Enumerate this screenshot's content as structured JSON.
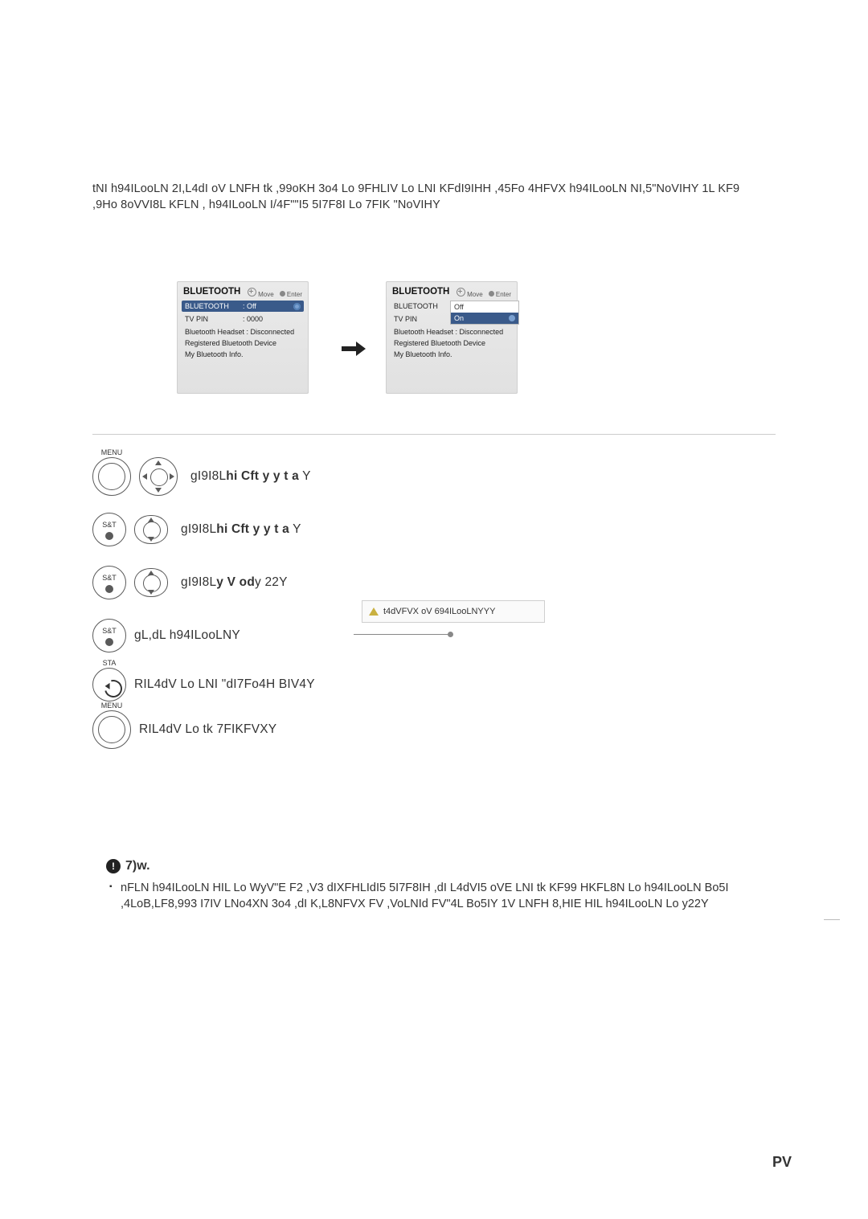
{
  "intro": {
    "line1": "tNI h94ILooLN 2I,L4dI oV LNFH tk ,99oKH 3o4 Lo 9FHLIV Lo LNI KFdI9IHH ,45Fo 4HFVX h94ILooLN NI,5\"NoVIHY 1L KF9",
    "line2": ",9Ho 8oVVI8L KFLN , h94ILooLN I/4F\"\"I5 5I7F8I Lo 7FIK \"NoVIHY"
  },
  "screenshot": {
    "title": "BLUETOOTH",
    "hint_move": "Move",
    "hint_enter": "Enter",
    "rows": {
      "bluetooth_label": "BLUETOOTH",
      "bluetooth_value": ": Off",
      "tvpin_label": "TV PIN",
      "tvpin_value": ": 0000",
      "headset": "Bluetooth Headset : Disconnected",
      "registered": "Registered Bluetooth Device",
      "myinfo": "My Bluetooth Info."
    },
    "dropdown": {
      "off": "Off",
      "on": "On"
    }
  },
  "steps": {
    "s1": {
      "btn": "MENU",
      "text_a": "gI9I8L",
      "text_b": "hi Cft y y t a",
      "text_c": " Y"
    },
    "s2": {
      "btn": "S&T",
      "text_a": "gI9I8L",
      "text_b": "hi Cft y y t a",
      "text_c": " Y"
    },
    "s3": {
      "btn": "S&T",
      "text_a": "gI9I8L",
      "text_b": "y V od",
      "text_c": "y 22Y"
    },
    "s4": {
      "btn": "S&T",
      "text": "gL,dL h94ILooLNY"
    },
    "s5": {
      "btn": "STA",
      "text": "RIL4dV Lo LNI \"dI7Fo4H BIV4Y"
    },
    "s6": {
      "btn": "MENU",
      "text": "RIL4dV Lo tk 7FIKFVXY"
    }
  },
  "callout": "t4dVFVX oV 694ILooLNYYY",
  "note": {
    "title": "7)w.",
    "body_l1": "nFLN h94ILooLN HIL Lo WyV\"E F2 ,V3 dIXFHLIdI5 5I7F8IH ,dI L4dVI5 oVE LNI tk KF99 HKFL8N Lo h94ILooLN Bo5I",
    "body_l2": ",4LoB,LF8,993 I7IV LNo4XN 3o4 ,dI K,L8NFVX FV ,VoLNId FV\"4L Bo5IY 1V LNFH 8,HIE HIL h94ILooLN Lo y22Y"
  },
  "page_number": "PV"
}
